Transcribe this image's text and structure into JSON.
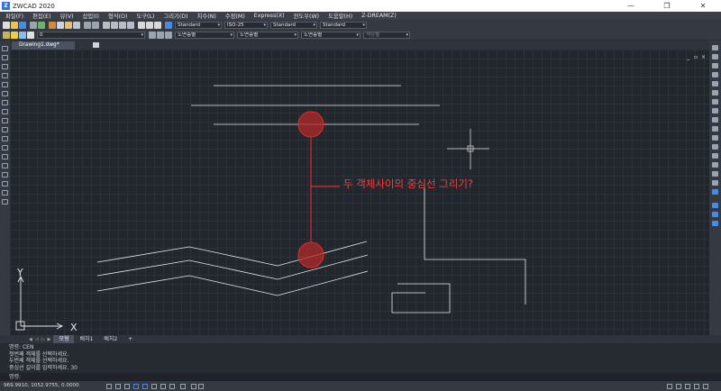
{
  "window": {
    "title": "ZWCAD 2020",
    "logo_text": "Z",
    "minimize": "—",
    "maximize": "❐",
    "close": "✕"
  },
  "menu": [
    "파일(F)",
    "편집(E)",
    "뷰(V)",
    "삽입(I)",
    "형식(O)",
    "도구(L)",
    "그리기(D)",
    "치수(N)",
    "수정(M)",
    "Express(X)",
    "윈도우(W)",
    "도움말(H)",
    "Z-DREAM(Z)"
  ],
  "toolbar1": {
    "text_style": "Standard",
    "dim_style": "ISO-25",
    "table_style": "Standard",
    "multileader_style": "Standard"
  },
  "toolbar2": {
    "layer_value": "0",
    "color_value": "도면층별",
    "linetype_value": "도면층별",
    "lineweight_value": "도면층별",
    "plotstyle_value": "색상별"
  },
  "doc_tab": {
    "label": "Drawing1.dwg*"
  },
  "viewport": {
    "minimize": "_",
    "restore": "▫",
    "close": "×"
  },
  "canvas": {
    "question": "두 객체사이의 중심선 그리기?",
    "ucs_x_label": "X",
    "ucs_y_label": "Y"
  },
  "layout_tabs": [
    {
      "label": "모형",
      "active": true
    },
    {
      "label": "배치1",
      "active": false
    },
    {
      "label": "배치2",
      "active": false
    },
    {
      "label": "+",
      "active": false
    }
  ],
  "command_history": [
    "명령: CEN",
    "첫번째 객체를 선택하세요.",
    "두번째 객체를 선택하세요.",
    "중심선 길이를 입력하세요. 30"
  ],
  "command_prompt": "명령:",
  "status": {
    "coordinates": "969.9910, 1052.9755, 0.0000"
  },
  "colors": {
    "accent_red": "#e02b2b",
    "canvas_bg": "#22262d",
    "ui_bg": "#343942"
  }
}
